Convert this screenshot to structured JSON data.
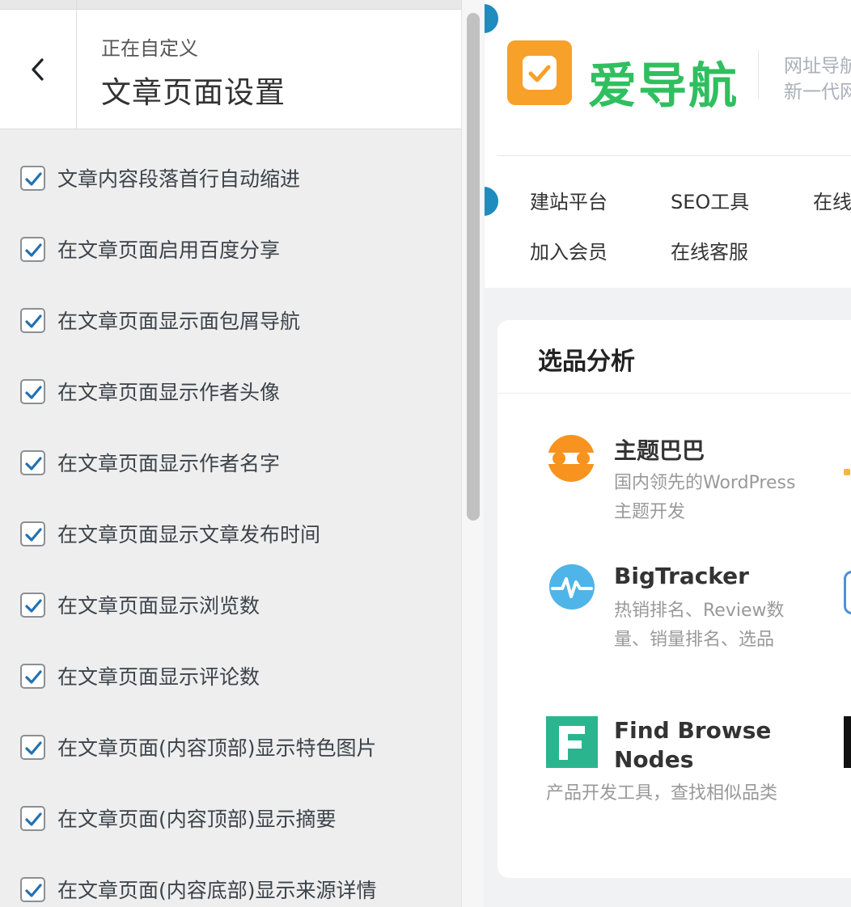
{
  "customizer": {
    "back_label": "返回",
    "subtitle": "正在自定义",
    "title": "文章页面设置",
    "options": [
      {
        "label": "文章内容段落首行自动缩进",
        "checked": true
      },
      {
        "label": "在文章页面启用百度分享",
        "checked": true
      },
      {
        "label": "在文章页面显示面包屑导航",
        "checked": true
      },
      {
        "label": "在文章页面显示作者头像",
        "checked": true
      },
      {
        "label": "在文章页面显示作者名字",
        "checked": true
      },
      {
        "label": "在文章页面显示文章发布时间",
        "checked": true
      },
      {
        "label": "在文章页面显示浏览数",
        "checked": true
      },
      {
        "label": "在文章页面显示评论数",
        "checked": true
      },
      {
        "label": "在文章页面(内容顶部)显示特色图片",
        "checked": true
      },
      {
        "label": "在文章页面(内容顶部)显示摘要",
        "checked": true
      },
      {
        "label": "在文章页面(内容底部)显示来源详情",
        "checked": true
      }
    ]
  },
  "preview": {
    "logo_icon": "checkmark-icon",
    "site_name": "爱导航",
    "slogan_line1": "网址导航",
    "slogan_line2": "新一代网",
    "nav": [
      {
        "label": "建站平台"
      },
      {
        "label": "SEO工具"
      },
      {
        "label": "在线工具"
      },
      {
        "label": "加入会员"
      },
      {
        "label": "在线客服"
      }
    ],
    "section_title": "选品分析",
    "sites": [
      {
        "name": "主题巴巴",
        "desc": "国内领先的WordPress主题开发",
        "icon": "themebaba-logo-icon",
        "color": "#f7931e"
      },
      {
        "name": "BigTracker",
        "desc": "热销排名、Review数量、销量排名、选品",
        "icon": "bigtracker-logo-icon",
        "color": "#4fb4e8"
      },
      {
        "name": "Find Browse Nodes",
        "desc": "产品开发工具，查找相似品类",
        "icon": "find-browse-nodes-logo-icon",
        "color": "#2bb58f"
      }
    ]
  },
  "colors": {
    "accent": "#2271b1",
    "brand_green": "#2fbf5f",
    "brand_orange": "#f7a02a",
    "edit_dot": "#1e8cbe"
  }
}
